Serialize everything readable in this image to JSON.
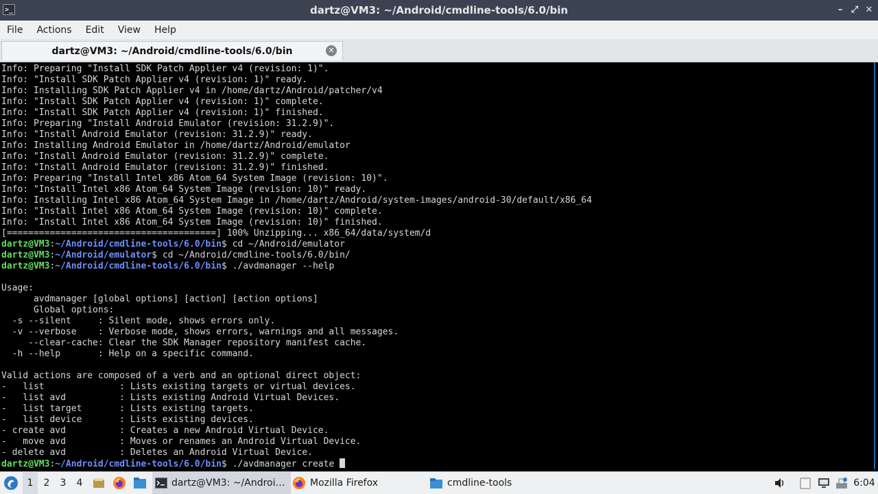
{
  "window": {
    "title": "dartz@VM3: ~/Android/cmdline-tools/6.0/bin",
    "app_icon_glyph": ">_",
    "minimize_glyph": "–",
    "maximize_glyph": "⤢",
    "close_glyph": "✕"
  },
  "menubar": {
    "items": [
      "File",
      "Actions",
      "Edit",
      "View",
      "Help"
    ]
  },
  "tab": {
    "label": "dartz@VM3: ~/Android/cmdline-tools/6.0/bin",
    "close_glyph": "✕"
  },
  "terminal": {
    "lines": [
      {
        "text": "Info: Preparing \"Install SDK Patch Applier v4 (revision: 1)\"."
      },
      {
        "text": "Info: \"Install SDK Patch Applier v4 (revision: 1)\" ready."
      },
      {
        "text": "Info: Installing SDK Patch Applier v4 in /home/dartz/Android/patcher/v4"
      },
      {
        "text": "Info: \"Install SDK Patch Applier v4 (revision: 1)\" complete."
      },
      {
        "text": "Info: \"Install SDK Patch Applier v4 (revision: 1)\" finished."
      },
      {
        "text": "Info: Preparing \"Install Android Emulator (revision: 31.2.9)\"."
      },
      {
        "text": "Info: \"Install Android Emulator (revision: 31.2.9)\" ready."
      },
      {
        "text": "Info: Installing Android Emulator in /home/dartz/Android/emulator"
      },
      {
        "text": "Info: \"Install Android Emulator (revision: 31.2.9)\" complete."
      },
      {
        "text": "Info: \"Install Android Emulator (revision: 31.2.9)\" finished."
      },
      {
        "text": "Info: Preparing \"Install Intel x86 Atom_64 System Image (revision: 10)\"."
      },
      {
        "text": "Info: \"Install Intel x86 Atom_64 System Image (revision: 10)\" ready."
      },
      {
        "text": "Info: Installing Intel x86 Atom_64 System Image in /home/dartz/Android/system-images/android-30/default/x86_64"
      },
      {
        "text": "Info: \"Install Intel x86 Atom_64 System Image (revision: 10)\" complete."
      },
      {
        "text": "Info: \"Install Intel x86 Atom_64 System Image (revision: 10)\" finished."
      },
      {
        "text": "[=======================================] 100% Unzipping... x86_64/data/system/d"
      },
      {
        "user": "dartz@VM3",
        "sep": ":",
        "path": "~/Android/cmdline-tools/6.0/bin",
        "cmd": "$ cd ~/Android/emulator"
      },
      {
        "user": "dartz@VM3",
        "sep": ":",
        "path": "~/Android/emulator",
        "cmd": "$ cd ~/Android/cmdline-tools/6.0/bin/"
      },
      {
        "user": "dartz@VM3",
        "sep": ":",
        "path": "~/Android/cmdline-tools/6.0/bin",
        "cmd": "$ ./avdmanager --help"
      },
      {
        "text": ""
      },
      {
        "text": "Usage:"
      },
      {
        "text": "      avdmanager [global options] [action] [action options]"
      },
      {
        "text": "      Global options:"
      },
      {
        "text": "  -s --silent     : Silent mode, shows errors only."
      },
      {
        "text": "  -v --verbose    : Verbose mode, shows errors, warnings and all messages."
      },
      {
        "text": "     --clear-cache: Clear the SDK Manager repository manifest cache."
      },
      {
        "text": "  -h --help       : Help on a specific command."
      },
      {
        "text": ""
      },
      {
        "text": "Valid actions are composed of a verb and an optional direct object:"
      },
      {
        "text": "-   list              : Lists existing targets or virtual devices."
      },
      {
        "text": "-   list avd          : Lists existing Android Virtual Devices."
      },
      {
        "text": "-   list target       : Lists existing targets."
      },
      {
        "text": "-   list device       : Lists existing devices."
      },
      {
        "text": "- create avd          : Creates a new Android Virtual Device."
      },
      {
        "text": "-   move avd          : Moves or renames an Android Virtual Device."
      },
      {
        "text": "- delete avd          : Deletes an Android Virtual Device."
      },
      {
        "user": "dartz@VM3",
        "sep": ":",
        "path": "~/Android/cmdline-tools/6.0/bin",
        "cmd": "$ ./avdmanager create ",
        "cursor": true
      }
    ]
  },
  "taskbar": {
    "start_icon": "start-menu-icon",
    "workspaces": [
      "1",
      "2",
      "3",
      "4"
    ],
    "active_workspace": "1",
    "tasks": [
      {
        "label": "dartz@VM3: ~/Androi…",
        "icon": "terminal-icon"
      },
      {
        "label": "Mozilla Firefox",
        "icon": "firefox-icon"
      },
      {
        "label": "cmdline-tools",
        "icon": "folder-icon"
      }
    ],
    "clock": "6:04",
    "colors": {
      "accent": "#1e6aa8",
      "prompt_user": "#5ee05e",
      "prompt_path": "#6f8fff"
    }
  }
}
